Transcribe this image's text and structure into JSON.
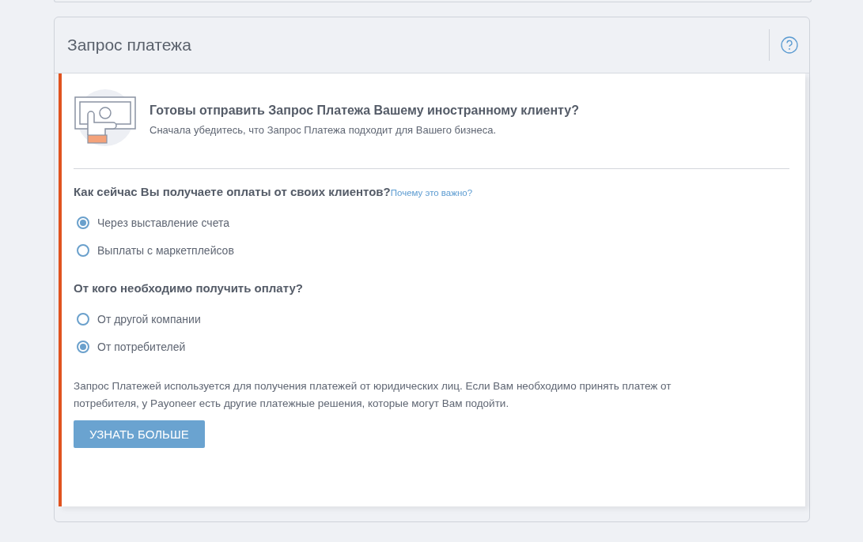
{
  "card": {
    "title": "Запрос платежа"
  },
  "intro": {
    "heading": "Готовы отправить Запрос Платежа Вашему иностранному клиенту?",
    "subtitle": "Сначала убедитесь, что Запрос Платежа подходит для Вашего бизнеса."
  },
  "questions": [
    {
      "label": "Как сейчас Вы получаете оплаты от своих клиентов?",
      "link": "Почему это важно?",
      "options": [
        {
          "label": "Через выставление счета",
          "selected": true
        },
        {
          "label": "Выплаты с маркетплейсов",
          "selected": false
        }
      ]
    },
    {
      "label": "От кого необходимо получить оплату?",
      "options": [
        {
          "label": "От другой компании",
          "selected": false
        },
        {
          "label": "От потребителей",
          "selected": true
        }
      ]
    }
  ],
  "notice": "Запрос Платежей используется для получения платежей от юридических лиц. Если Вам необходимо принять платеж от потребителя, у Payoneer есть другие платежные решения, которые могут Вам подойти.",
  "button": "УЗНАТЬ БОЛЬШЕ"
}
